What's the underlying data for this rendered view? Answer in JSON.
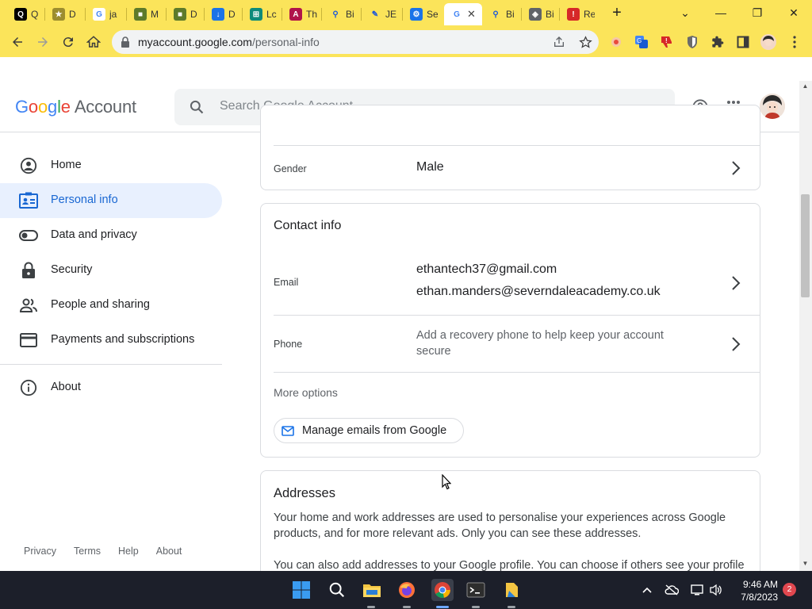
{
  "browser": {
    "tabs": [
      {
        "title": "Q",
        "fav_color": "#000000",
        "fav_glyph": "Q"
      },
      {
        "title": "D",
        "fav_color": "#9c8d2e",
        "fav_glyph": "★"
      },
      {
        "title": "ja",
        "fav_color": "#ffffff",
        "fav_glyph": "G"
      },
      {
        "title": "M",
        "fav_color": "#5d7a2a",
        "fav_glyph": "■"
      },
      {
        "title": "D",
        "fav_color": "#5d7a2a",
        "fav_glyph": "■"
      },
      {
        "title": "D",
        "fav_color": "#1a73e8",
        "fav_glyph": "↓"
      },
      {
        "title": "Lc",
        "fav_color": "#0d8a7a",
        "fav_glyph": "⊞"
      },
      {
        "title": "Th",
        "fav_color": "#b0144a",
        "fav_glyph": "A"
      },
      {
        "title": "Bi",
        "fav_color": "#fbe45a",
        "fav_glyph": "⚲"
      },
      {
        "title": "JE",
        "fav_color": "#fbe45a",
        "fav_glyph": "✎"
      },
      {
        "title": "Se",
        "fav_color": "#1a73e8",
        "fav_glyph": "⚙"
      },
      {
        "title": "",
        "fav_color": "#ffffff",
        "fav_glyph": "G",
        "active": true
      },
      {
        "title": "Bi",
        "fav_color": "#fbe45a",
        "fav_glyph": "⚲"
      },
      {
        "title": "Bi",
        "fav_color": "#5f6368",
        "fav_glyph": "◈"
      },
      {
        "title": "Re",
        "fav_color": "#d62828",
        "fav_glyph": "!"
      }
    ],
    "url_host": "myaccount.google.com",
    "url_path": "/personal-info"
  },
  "header": {
    "logo_letters": [
      "G",
      "o",
      "o",
      "g",
      "l",
      "e"
    ],
    "logo_suffix": "Account",
    "search_placeholder": "Search Google Account"
  },
  "sidebar": {
    "items": [
      {
        "label": "Home",
        "icon": "account-circle-icon"
      },
      {
        "label": "Personal info",
        "icon": "badge-icon",
        "active": true
      },
      {
        "label": "Data and privacy",
        "icon": "toggle-icon"
      },
      {
        "label": "Security",
        "icon": "lock-icon"
      },
      {
        "label": "People and sharing",
        "icon": "people-icon"
      },
      {
        "label": "Payments and subscriptions",
        "icon": "credit-card-icon"
      }
    ],
    "about": "About",
    "footer": [
      "Privacy",
      "Terms",
      "Help",
      "About"
    ]
  },
  "main": {
    "gender": {
      "label": "Gender",
      "value": "Male"
    },
    "contact": {
      "title": "Contact info",
      "email_label": "Email",
      "emails": [
        "ethantech37@gmail.com",
        "ethan.manders@severndaleacademy.co.uk"
      ],
      "phone_label": "Phone",
      "phone_value": "Add a recovery phone to help keep your account secure",
      "more_options": "More options",
      "manage_emails": "Manage emails from Google"
    },
    "addresses": {
      "title": "Addresses",
      "text1": "Your home and work addresses are used to personalise your experiences across Google products, and for more relevant ads. Only you can see these addresses.",
      "text2": "You can also add addresses to your Google profile. You can choose if others see your profile"
    }
  },
  "taskbar": {
    "time": "9:46 AM",
    "date": "7/8/2023",
    "notifications": "2"
  },
  "colors": {
    "accent": "#1967d2",
    "active_bg": "#e8f0fe",
    "chrome_frame": "#fbe45a"
  }
}
